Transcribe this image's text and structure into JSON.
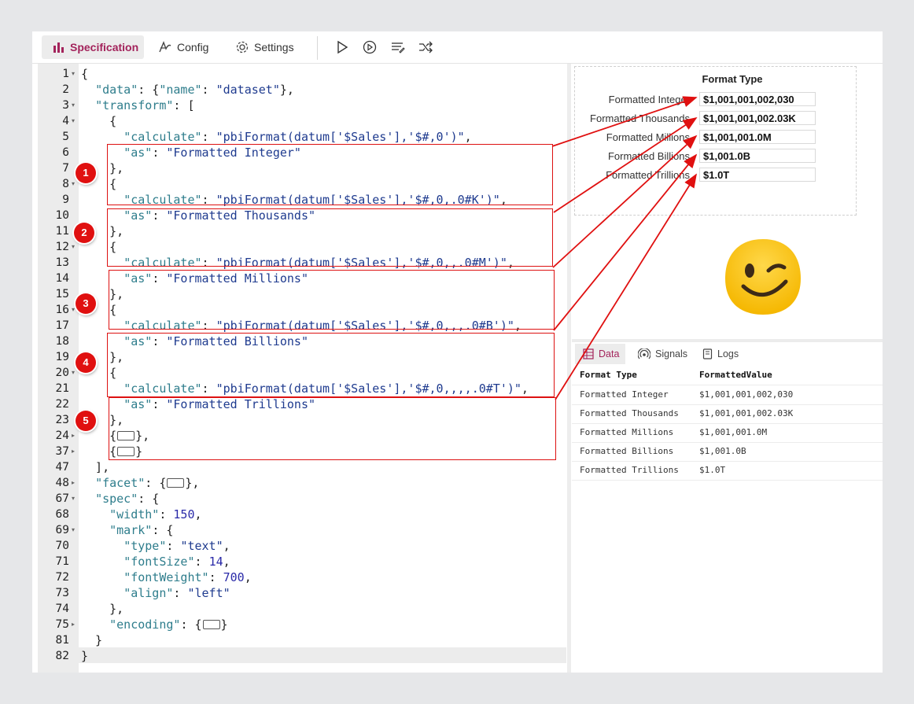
{
  "toolbar": {
    "tabs": [
      {
        "label": "Specification",
        "icon": "bar-chart-icon"
      },
      {
        "label": "Config",
        "icon": "config-icon"
      },
      {
        "label": "Settings",
        "icon": "gear-icon"
      }
    ],
    "actions": [
      "play-icon",
      "step-icon",
      "format-icon",
      "shuffle-icon"
    ]
  },
  "editor": {
    "lines": [
      {
        "n": "1",
        "fold": "▾",
        "t": [
          [
            "p",
            "{"
          ]
        ]
      },
      {
        "n": "2",
        "fold": "",
        "t": [
          [
            "p",
            "  "
          ],
          [
            "k",
            "\"data\""
          ],
          [
            "p",
            ": {"
          ],
          [
            "k",
            "\"name\""
          ],
          [
            "p",
            ": "
          ],
          [
            "s",
            "\"dataset\""
          ],
          [
            "p",
            "},"
          ]
        ]
      },
      {
        "n": "3",
        "fold": "▾",
        "t": [
          [
            "p",
            "  "
          ],
          [
            "k",
            "\"transform\""
          ],
          [
            "p",
            ": ["
          ]
        ]
      },
      {
        "n": "4",
        "fold": "▾",
        "t": [
          [
            "p",
            "    {"
          ]
        ]
      },
      {
        "n": "5",
        "fold": "",
        "t": [
          [
            "p",
            "      "
          ],
          [
            "k",
            "\"calculate\""
          ],
          [
            "p",
            ": "
          ],
          [
            "s",
            "\"pbiFormat(datum['$Sales'],'$#,0')\""
          ],
          [
            "p",
            ","
          ]
        ]
      },
      {
        "n": "6",
        "fold": "",
        "t": [
          [
            "p",
            "      "
          ],
          [
            "k",
            "\"as\""
          ],
          [
            "p",
            ": "
          ],
          [
            "s",
            "\"Formatted Integer\""
          ]
        ]
      },
      {
        "n": "7",
        "fold": "",
        "t": [
          [
            "p",
            "    },"
          ]
        ]
      },
      {
        "n": "8",
        "fold": "▾",
        "t": [
          [
            "p",
            "    {"
          ]
        ]
      },
      {
        "n": "9",
        "fold": "",
        "t": [
          [
            "p",
            "      "
          ],
          [
            "k",
            "\"calculate\""
          ],
          [
            "p",
            ": "
          ],
          [
            "s",
            "\"pbiFormat(datum['$Sales'],'$#,0,.0#K')\""
          ],
          [
            "p",
            ","
          ]
        ]
      },
      {
        "n": "10",
        "fold": "",
        "t": [
          [
            "p",
            "      "
          ],
          [
            "k",
            "\"as\""
          ],
          [
            "p",
            ": "
          ],
          [
            "s",
            "\"Formatted Thousands\""
          ]
        ]
      },
      {
        "n": "11",
        "fold": "",
        "t": [
          [
            "p",
            "    },"
          ]
        ]
      },
      {
        "n": "12",
        "fold": "▾",
        "t": [
          [
            "p",
            "    {"
          ]
        ]
      },
      {
        "n": "13",
        "fold": "",
        "t": [
          [
            "p",
            "      "
          ],
          [
            "k",
            "\"calculate\""
          ],
          [
            "p",
            ": "
          ],
          [
            "s",
            "\"pbiFormat(datum['$Sales'],'$#,0,,.0#M')\""
          ],
          [
            "p",
            ","
          ]
        ]
      },
      {
        "n": "14",
        "fold": "",
        "t": [
          [
            "p",
            "      "
          ],
          [
            "k",
            "\"as\""
          ],
          [
            "p",
            ": "
          ],
          [
            "s",
            "\"Formatted Millions\""
          ]
        ]
      },
      {
        "n": "15",
        "fold": "",
        "t": [
          [
            "p",
            "    },"
          ]
        ]
      },
      {
        "n": "16",
        "fold": "▾",
        "t": [
          [
            "p",
            "    {"
          ]
        ]
      },
      {
        "n": "17",
        "fold": "",
        "t": [
          [
            "p",
            "      "
          ],
          [
            "k",
            "\"calculate\""
          ],
          [
            "p",
            ": "
          ],
          [
            "s",
            "\"pbiFormat(datum['$Sales'],'$#,0,,,.0#B')\""
          ],
          [
            "p",
            ","
          ]
        ]
      },
      {
        "n": "18",
        "fold": "",
        "t": [
          [
            "p",
            "      "
          ],
          [
            "k",
            "\"as\""
          ],
          [
            "p",
            ": "
          ],
          [
            "s",
            "\"Formatted Billions\""
          ]
        ]
      },
      {
        "n": "19",
        "fold": "",
        "t": [
          [
            "p",
            "    },"
          ]
        ]
      },
      {
        "n": "20",
        "fold": "▾",
        "t": [
          [
            "p",
            "    {"
          ]
        ]
      },
      {
        "n": "21",
        "fold": "",
        "t": [
          [
            "p",
            "      "
          ],
          [
            "k",
            "\"calculate\""
          ],
          [
            "p",
            ": "
          ],
          [
            "s",
            "\"pbiFormat(datum['$Sales'],'$#,0,,,,.0#T')\""
          ],
          [
            "p",
            ","
          ]
        ]
      },
      {
        "n": "22",
        "fold": "",
        "t": [
          [
            "p",
            "      "
          ],
          [
            "k",
            "\"as\""
          ],
          [
            "p",
            ": "
          ],
          [
            "s",
            "\"Formatted Trillions\""
          ]
        ]
      },
      {
        "n": "23",
        "fold": "",
        "t": [
          [
            "p",
            "    },"
          ]
        ]
      },
      {
        "n": "24",
        "fold": "▸",
        "t": [
          [
            "p",
            "    {"
          ],
          [
            "c",
            ""
          ],
          [
            "p",
            "},"
          ]
        ]
      },
      {
        "n": "37",
        "fold": "▸",
        "t": [
          [
            "p",
            "    {"
          ],
          [
            "c",
            ""
          ],
          [
            "p",
            "}"
          ]
        ]
      },
      {
        "n": "47",
        "fold": "",
        "t": [
          [
            "p",
            "  ],"
          ]
        ]
      },
      {
        "n": "48",
        "fold": "▸",
        "t": [
          [
            "p",
            "  "
          ],
          [
            "k",
            "\"facet\""
          ],
          [
            "p",
            ": {"
          ],
          [
            "c",
            ""
          ],
          [
            "p",
            "},"
          ]
        ]
      },
      {
        "n": "67",
        "fold": "▾",
        "t": [
          [
            "p",
            "  "
          ],
          [
            "k",
            "\"spec\""
          ],
          [
            "p",
            ": {"
          ]
        ]
      },
      {
        "n": "68",
        "fold": "",
        "t": [
          [
            "p",
            "    "
          ],
          [
            "k",
            "\"width\""
          ],
          [
            "p",
            ": "
          ],
          [
            "n",
            "150"
          ],
          [
            "p",
            ","
          ]
        ]
      },
      {
        "n": "69",
        "fold": "▾",
        "t": [
          [
            "p",
            "    "
          ],
          [
            "k",
            "\"mark\""
          ],
          [
            "p",
            ": {"
          ]
        ]
      },
      {
        "n": "70",
        "fold": "",
        "t": [
          [
            "p",
            "      "
          ],
          [
            "k",
            "\"type\""
          ],
          [
            "p",
            ": "
          ],
          [
            "s",
            "\"text\""
          ],
          [
            "p",
            ","
          ]
        ]
      },
      {
        "n": "71",
        "fold": "",
        "t": [
          [
            "p",
            "      "
          ],
          [
            "k",
            "\"fontSize\""
          ],
          [
            "p",
            ": "
          ],
          [
            "n",
            "14"
          ],
          [
            "p",
            ","
          ]
        ]
      },
      {
        "n": "72",
        "fold": "",
        "t": [
          [
            "p",
            "      "
          ],
          [
            "k",
            "\"fontWeight\""
          ],
          [
            "p",
            ": "
          ],
          [
            "n",
            "700"
          ],
          [
            "p",
            ","
          ]
        ]
      },
      {
        "n": "73",
        "fold": "",
        "t": [
          [
            "p",
            "      "
          ],
          [
            "k",
            "\"align\""
          ],
          [
            "p",
            ": "
          ],
          [
            "s",
            "\"left\""
          ]
        ]
      },
      {
        "n": "74",
        "fold": "",
        "t": [
          [
            "p",
            "    },"
          ]
        ]
      },
      {
        "n": "75",
        "fold": "▸",
        "t": [
          [
            "p",
            "    "
          ],
          [
            "k",
            "\"encoding\""
          ],
          [
            "p",
            ": {"
          ],
          [
            "c",
            ""
          ],
          [
            "p",
            "}"
          ]
        ]
      },
      {
        "n": "81",
        "fold": "",
        "t": [
          [
            "p",
            "  }"
          ]
        ]
      },
      {
        "n": "82",
        "fold": "",
        "t": [
          [
            "p",
            "}"
          ]
        ]
      }
    ],
    "callouts": [
      "1",
      "2",
      "3",
      "4",
      "5"
    ]
  },
  "visual": {
    "title": "Format Type",
    "rows": [
      {
        "label": "Formatted Integer",
        "value": "$1,001,001,002,030"
      },
      {
        "label": "Formatted Thousands",
        "value": "$1,001,001,002.03K"
      },
      {
        "label": "Formatted Millions",
        "value": "$1,001,001.0M"
      },
      {
        "label": "Formatted Billions",
        "value": "$1,001.0B"
      },
      {
        "label": "Formatted Trillions",
        "value": "$1.0T"
      }
    ],
    "emoji": "winking-face"
  },
  "bottom_panel": {
    "tabs": [
      {
        "label": "Data",
        "icon": "table-icon"
      },
      {
        "label": "Signals",
        "icon": "signal-icon"
      },
      {
        "label": "Logs",
        "icon": "log-icon"
      }
    ],
    "columns": [
      "Format Type",
      "FormattedValue"
    ],
    "rows": [
      [
        "Formatted Integer",
        "$1,001,001,002,030"
      ],
      [
        "Formatted Thousands",
        "$1,001,001,002.03K"
      ],
      [
        "Formatted Millions",
        "$1,001,001.0M"
      ],
      [
        "Formatted Billions",
        "$1,001.0B"
      ],
      [
        "Formatted Trillions",
        "$1.0T"
      ]
    ]
  },
  "colors": {
    "accent": "#a3235b",
    "annotation": "#e01010"
  }
}
